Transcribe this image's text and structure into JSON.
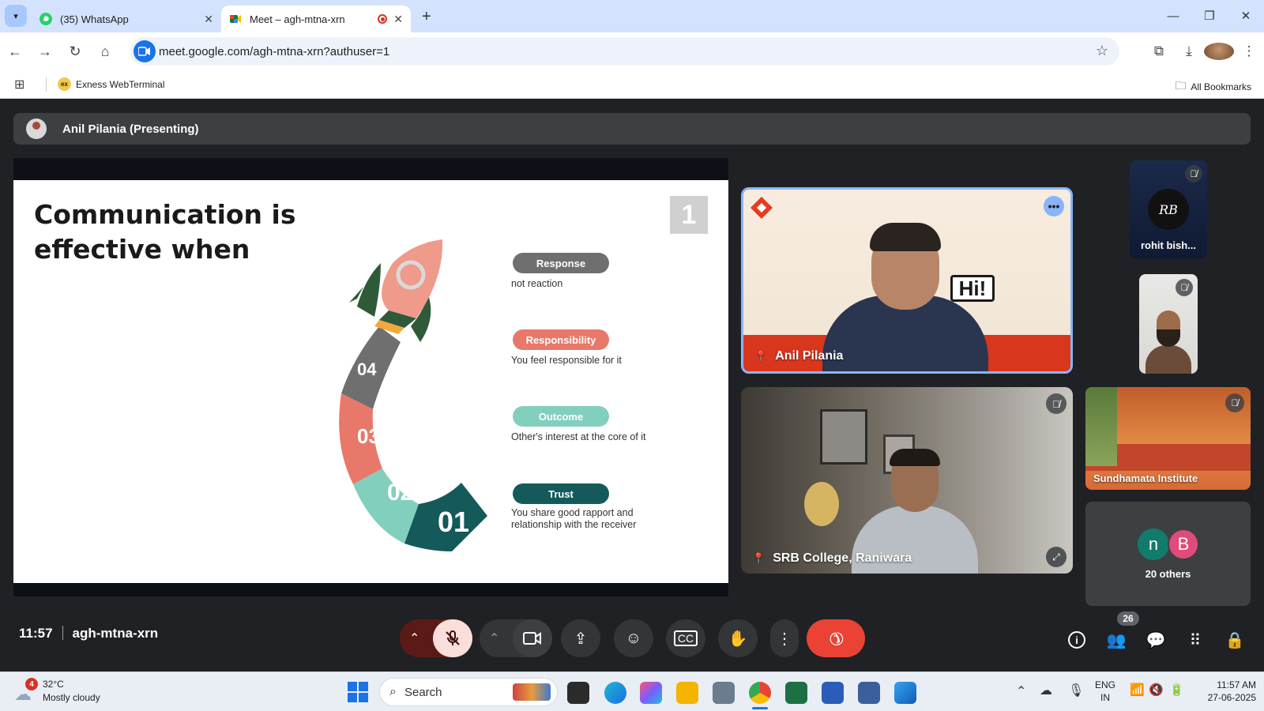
{
  "browser": {
    "tabs": [
      {
        "title": "(35) WhatsApp",
        "active": false
      },
      {
        "title": "Meet – agh-mtna-xrn",
        "active": true
      }
    ],
    "url": "meet.google.com/agh-mtna-xrn?authuser=1",
    "bookmarks": [
      {
        "label": "Exness WebTerminal",
        "icon": "ex"
      }
    ],
    "all_bookmarks_label": "All Bookmarks"
  },
  "meet": {
    "presenting_label": "Anil Pilania (Presenting)",
    "slide": {
      "title": "Communication is effective when",
      "page_number": "1",
      "steps": [
        {
          "number": "04",
          "label": "Response",
          "desc": "not reaction",
          "color": "#6f6f6f"
        },
        {
          "number": "03",
          "label": "Responsibility",
          "desc": "You feel responsible for it",
          "color": "#e8786a"
        },
        {
          "number": "02",
          "label": "Outcome",
          "desc": "Other's interest at the core of it",
          "color": "#82cfbd"
        },
        {
          "number": "01",
          "label": "Trust",
          "desc": "You share good rapport and relationship with the receiver",
          "color": "#145a5a"
        }
      ]
    },
    "participants": {
      "main": {
        "name": "Anil Pilania",
        "sign_text": "Hi!"
      },
      "second": {
        "name": "SRB College, Raniwara"
      },
      "rohit": {
        "name": "rohit bish...",
        "initials": "RB"
      },
      "sundhamata": {
        "name": "Sundhamata Institute"
      },
      "others": {
        "label": "20 others",
        "avatars": [
          "n",
          "B"
        ]
      }
    },
    "time": "11:57",
    "meeting_code": "agh-mtna-xrn",
    "people_count": "26"
  },
  "taskbar": {
    "weather": {
      "temp": "32°C",
      "desc": "Mostly cloudy",
      "badge": "4"
    },
    "search_label": "Search",
    "language": {
      "line1": "ENG",
      "line2": "IN"
    },
    "clock": {
      "time": "11:57 AM",
      "date": "27-06-2025"
    }
  },
  "colors": {
    "end_call": "#ea4335",
    "mic_off_bg": "#f9dedc",
    "meet_bg": "#202124"
  }
}
